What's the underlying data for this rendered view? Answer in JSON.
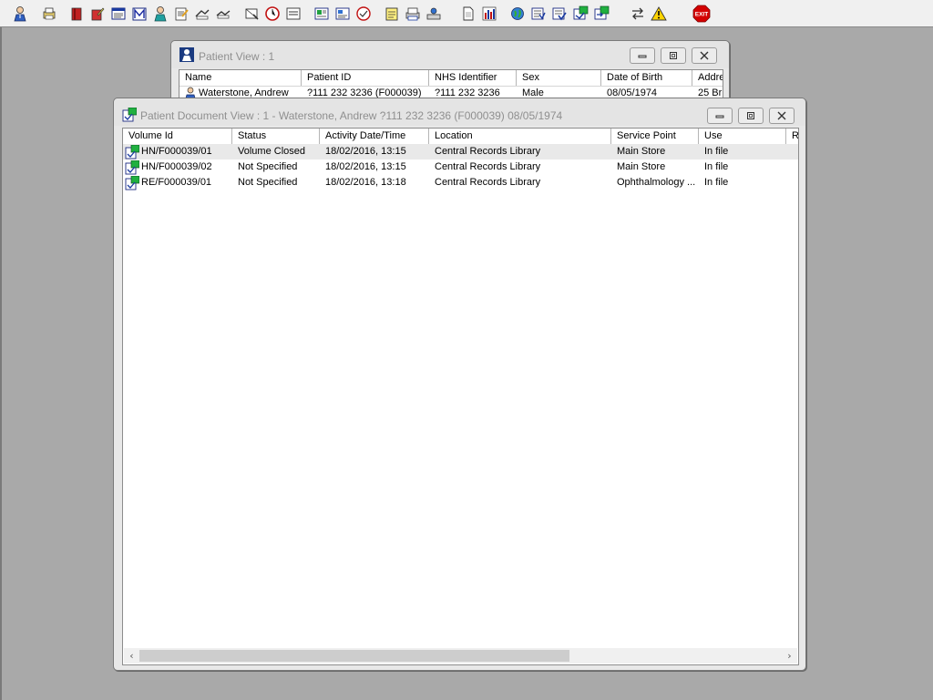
{
  "toolbar": {
    "icons": [
      "patient-search-icon",
      "print-icon",
      "book-icon",
      "book-edit-icon",
      "list-window-icon",
      "mail-m-icon",
      "doctor-icon",
      "notes-icon",
      "transfer-icon",
      "transfer2-icon",
      "tracking-icon",
      "clock-icon",
      "form-icon",
      "card-icon",
      "card2-icon",
      "audit-icon",
      "notepad-icon",
      "printer-icon",
      "scan-icon",
      "document-icon",
      "chart-bars-icon",
      "globe-icon",
      "docs-icon",
      "docs-check-icon",
      "docs-green-icon",
      "docs-arrow-icon",
      "swap-icon",
      "warning-icon",
      "exit-icon"
    ],
    "exit_label": "EXIT"
  },
  "patient_view": {
    "title": "Patient View : 1",
    "columns": [
      "Name",
      "Patient ID",
      "NHS Identifier",
      "Sex",
      "Date of Birth",
      "Addre"
    ],
    "rows": [
      {
        "name": "Waterstone, Andrew",
        "patient_id": "?111 232 3236 (F000039)",
        "nhs": "?111 232 3236",
        "sex": "Male",
        "dob": "08/05/1974",
        "address": "25 Br"
      }
    ]
  },
  "document_view": {
    "title": "Patient Document View : 1 - Waterstone, Andrew ?111 232 3236 (F000039) 08/05/1974",
    "columns": [
      "Volume Id",
      "Status",
      "Activity Date/Time",
      "Location",
      "Service Point",
      "Use",
      "R"
    ],
    "rows": [
      {
        "volume_id": "HN/F000039/01",
        "status": "Volume Closed",
        "activity": "18/02/2016, 13:15",
        "location": "Central Records Library",
        "service_point": "Main Store",
        "use": "In file"
      },
      {
        "volume_id": "HN/F000039/02",
        "status": "Not Specified",
        "activity": "18/02/2016, 13:15",
        "location": "Central Records Library",
        "service_point": "Main Store",
        "use": "In file"
      },
      {
        "volume_id": "RE/F000039/01",
        "status": "Not Specified",
        "activity": "18/02/2016, 13:18",
        "location": "Central Records Library",
        "service_point": "Ophthalmology ...",
        "use": "In file"
      }
    ],
    "scroll_left_glyph": "‹",
    "scroll_right_glyph": "›"
  },
  "colors": {
    "desktop": "#a9a9a9",
    "window_title_text": "#8f8f8f",
    "alt_row": "#e9e9e9",
    "exit_red": "#d40000",
    "warning_yellow": "#ffd400"
  }
}
